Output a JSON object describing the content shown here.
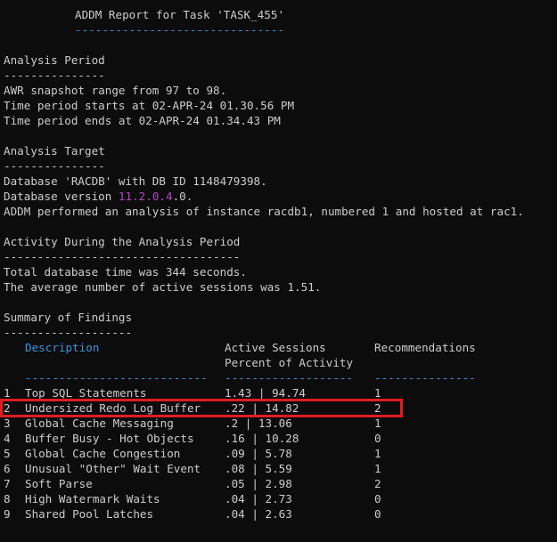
{
  "header": {
    "title": "ADDM Report for Task 'TASK_455'",
    "underline": "-------------------------------"
  },
  "analysis_period": {
    "heading": "Analysis Period",
    "underline": "---------------",
    "line1": "AWR snapshot range from 97 to 98.",
    "line2": "Time period starts at 02-APR-24 01.30.56 PM",
    "line3": "Time period ends at 02-APR-24 01.34.43 PM"
  },
  "analysis_target": {
    "heading": "Analysis Target",
    "underline": "---------------",
    "line1": "Database 'RACDB' with DB ID 1148479398.",
    "version_prefix": "Database version ",
    "version_value": "11.2.0.4",
    "version_suffix": ".0.",
    "line3": "ADDM performed an analysis of instance racdb1, numbered 1 and hosted at rac1."
  },
  "activity": {
    "heading": "Activity During the Analysis Period",
    "underline": "-----------------------------------",
    "line1": "Total database time was 344 seconds.",
    "line2": "The average number of active sessions was 1.51."
  },
  "summary": {
    "heading": "Summary of Findings",
    "underline": "-------------------",
    "col_description": "Description",
    "col_active_1": "Active Sessions",
    "col_active_2": "Percent of Activity",
    "col_recommendations": "Recommendations",
    "desc_underline": "---------------------------",
    "active_underline": "-------------------",
    "rec_underline": "---------------",
    "rows": [
      {
        "num": "1",
        "desc": "Top SQL Statements",
        "active": "1.43 | 94.74",
        "rec": "1"
      },
      {
        "num": "2",
        "desc": "Undersized Redo Log Buffer",
        "active": ".22 | 14.82",
        "rec": "2"
      },
      {
        "num": "3",
        "desc": "Global Cache Messaging",
        "active": ".2 | 13.06",
        "rec": "1"
      },
      {
        "num": "4",
        "desc": "Buffer Busy - Hot Objects",
        "active": ".16 | 10.28",
        "rec": "0"
      },
      {
        "num": "5",
        "desc": "Global Cache Congestion",
        "active": ".09 | 5.78",
        "rec": "1"
      },
      {
        "num": "6",
        "desc": "Unusual \"Other\" Wait Event",
        "active": ".08 | 5.59",
        "rec": "1"
      },
      {
        "num": "7",
        "desc": "Soft Parse",
        "active": ".05 | 2.98",
        "rec": "2"
      },
      {
        "num": "8",
        "desc": "High Watermark Waits",
        "active": ".04 | 2.73",
        "rec": "0"
      },
      {
        "num": "9",
        "desc": "Shared Pool Latches",
        "active": ".04 | 2.63",
        "rec": "0"
      }
    ]
  },
  "colors": {
    "background": "#0c0c0c",
    "text": "#cccccc",
    "accent_cyan": "#3a96dd",
    "accent_magenta": "#b148c6",
    "highlight_border": "#e01b24"
  }
}
